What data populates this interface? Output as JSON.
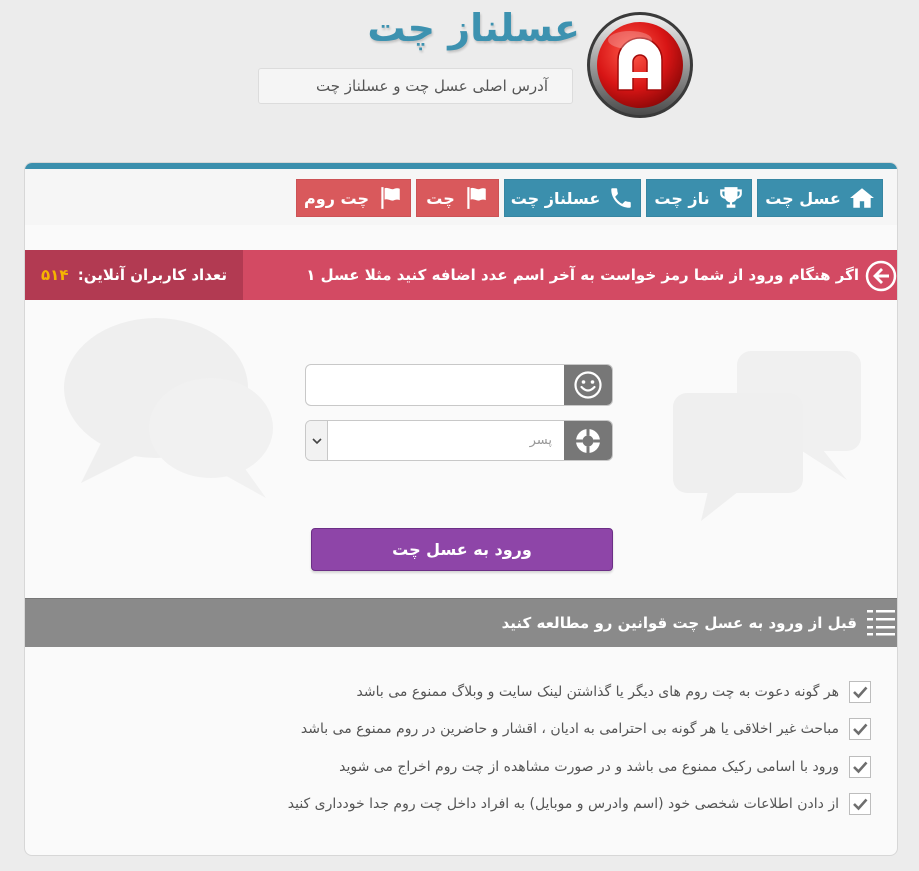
{
  "header": {
    "site_title": "عسلناز چت",
    "subtitle": "آدرس اصلی عسل چت و عسلناز چت",
    "logo_icon": "lock-logo-icon"
  },
  "nav": {
    "items": [
      {
        "label": "عسل چت",
        "icon": "home-icon",
        "color": "#3b8fad"
      },
      {
        "label": "ناز چت",
        "icon": "trophy-icon",
        "color": "#3b8fad"
      },
      {
        "label": "عسلناز چت",
        "icon": "phone-icon",
        "color": "#3b8fad"
      },
      {
        "label": "چت",
        "icon": "flag-icon",
        "color": "#d9595c"
      },
      {
        "label": "چت روم",
        "icon": "flag-icon",
        "color": "#d9595c"
      }
    ]
  },
  "notice": {
    "text": "اگر هنگام ورود از شما رمز خواست به آخر اسم عدد اضافه کنید مثلا عسل ۱",
    "online_label": "تعداد کاربران آنلاین:",
    "online_count": "۵۱۴"
  },
  "login": {
    "username_value": "",
    "username_placeholder": "",
    "gender_selected": "پسر",
    "submit_label": "ورود به  عسل چت"
  },
  "rules": {
    "title": "قبل از ورود به عسل چت قوانین رو مطالعه کنید",
    "items": [
      "هر گونه دعوت به چت روم های دیگر یا گذاشتن لینک سایت و وبلاگ ممنوع می باشد",
      "مباحث غیر اخلاقی یا هر گونه بی احترامی به ادیان ، اقشار و حاضرین در روم ممنوع می باشد",
      "ورود با اسامی رکیک ممنوع می باشد و در صورت مشاهده از چت روم اخراج می شوید",
      "از دادن اطلاعات شخصی خود (اسم وادرس و موبایل) به افراد داخل چت روم جدا خودداری کنید"
    ]
  },
  "colors": {
    "accent_blue": "#3b8fad",
    "nav_red": "#d9595c",
    "notice_pink": "#d34a63",
    "online_dark": "#b23a52",
    "count_yellow": "#f5b400",
    "submit_purple": "#8e45a8",
    "rules_gray": "#8a8a8a"
  }
}
